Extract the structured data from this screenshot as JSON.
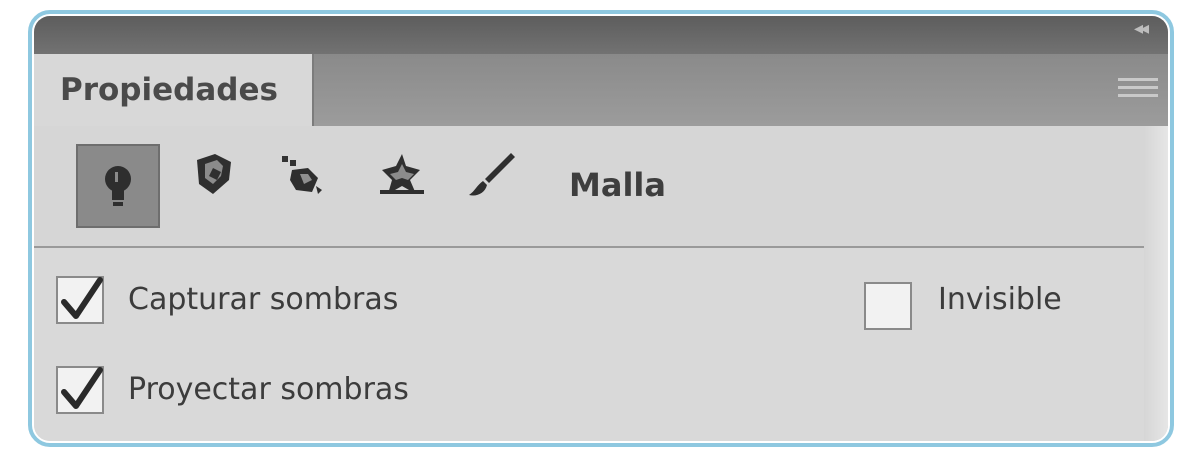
{
  "panel": {
    "tab_label": "Propiedades",
    "collapse_icon": "double-arrow-icon",
    "menu_icon": "panel-menu-icon"
  },
  "toolbar": {
    "tools": [
      {
        "icon": "light-bulb-icon",
        "active": true
      },
      {
        "icon": "mesh-icon",
        "active": false
      },
      {
        "icon": "deform-icon",
        "active": false
      },
      {
        "icon": "cap-icon",
        "active": false
      },
      {
        "icon": "brush-icon",
        "active": false
      }
    ],
    "section_label": "Malla"
  },
  "options": {
    "capture_shadows": {
      "label": "Capturar sombras",
      "checked": true
    },
    "cast_shadows": {
      "label": "Proyectar sombras",
      "checked": true
    },
    "invisible": {
      "label": "Invisible",
      "checked": false
    }
  },
  "colors": {
    "frame_border": "#8ec8e0",
    "titlebar": "#666666",
    "panel_bg": "#d6d6d6"
  }
}
